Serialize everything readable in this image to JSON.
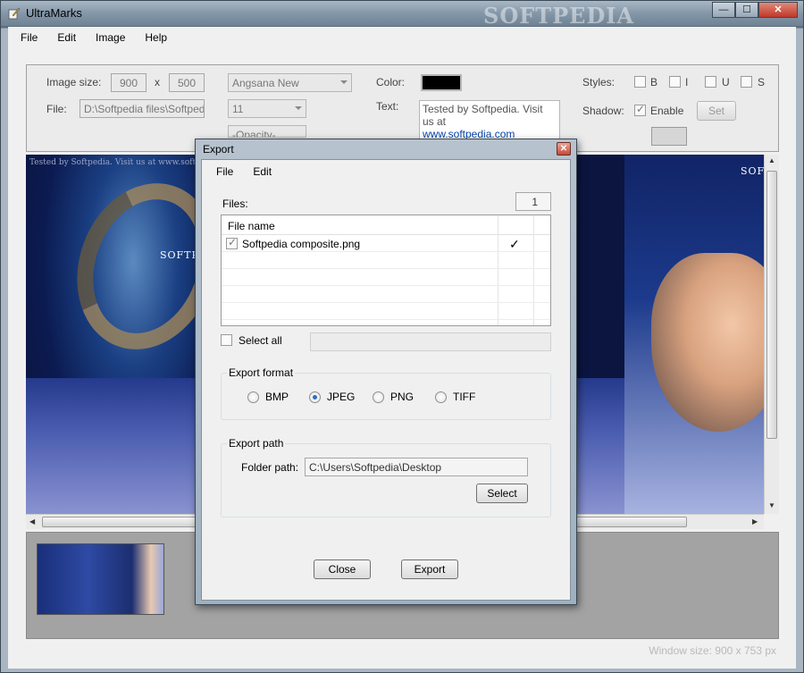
{
  "window": {
    "title": "UltraMarks",
    "watermark": "SOFTPEDIA",
    "caption": {
      "minimize": "—",
      "maximize": "☐",
      "close": "✕"
    }
  },
  "menu": [
    "File",
    "Edit",
    "Image",
    "Help"
  ],
  "toolbar": {
    "image_size_label": "Image size:",
    "width": "900",
    "x": "x",
    "height": "500",
    "font": "Angsana New",
    "font_size": "11",
    "opacity": "-Opacity-",
    "file_label": "File:",
    "file_path": "D:\\Softpedia files\\Softpedia",
    "color_label": "Color:",
    "text_label": "Text:",
    "text_value": "Tested by Softpedia. Visit us at",
    "text_link": "www.softpedia.com",
    "styles_label": "Styles:",
    "style_b": "B",
    "style_i": "I",
    "style_u": "U",
    "style_s": "S",
    "shadow_label": "Shadow:",
    "shadow_enable": "Enable",
    "set_button": "Set",
    "shadow_checked": true,
    "color_value": "#000000"
  },
  "canvas": {
    "brand_left": "SOFTPEDIA",
    "brand_right": "SOFT",
    "overlay_text": "Tested by Softpedia. Visit us at www.softpedia.com"
  },
  "status": "Window size: 900 x 753 px",
  "dialog": {
    "title": "Export",
    "close": "✕",
    "menu": [
      "File",
      "Edit"
    ],
    "files_label": "Files:",
    "files_count": "1",
    "file_column": "File name",
    "files": [
      {
        "name": "Softpedia composite.png",
        "checked": true,
        "status": "✓"
      }
    ],
    "select_all": "Select all",
    "format_group": "Export format",
    "formats": [
      "BMP",
      "JPEG",
      "PNG",
      "TIFF"
    ],
    "selected_format": "JPEG",
    "path_group": "Export path",
    "folder_label": "Folder path:",
    "folder_path": "C:\\Users\\Softpedia\\Desktop",
    "select_button": "Select",
    "close_button": "Close",
    "export_button": "Export"
  }
}
